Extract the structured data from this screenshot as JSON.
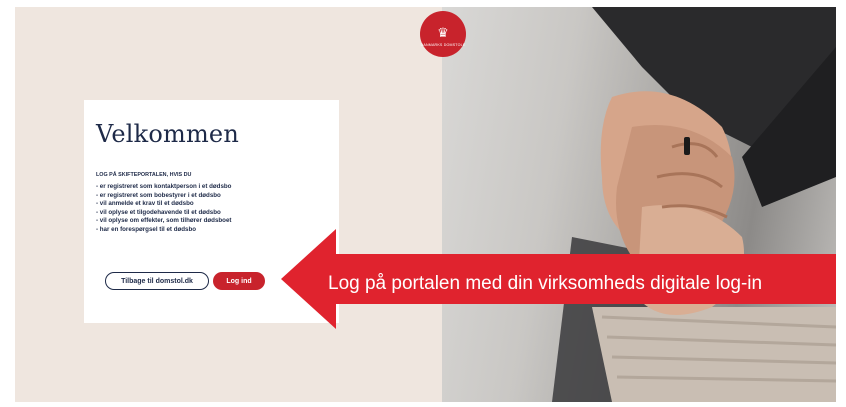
{
  "logo": {
    "symbol": "♛",
    "text": "Danmarks Domstole",
    "color": "#c8232c"
  },
  "card": {
    "title": "Velkommen",
    "subheading": "LOG PÅ SKIFTEPORTALEN, HVIS DU",
    "bullets": [
      "- er registreret som kontaktperson i et dødsbo",
      "- er registreret som bobestyrer i et dødsbo",
      "- vil anmelde et krav til et dødsbo",
      "- vil oplyse et tilgodehavende til et dødsbo",
      "- vil oplyse om effekter, som tilhører dødsboet",
      "- har en forespørgsel til et dødsbo"
    ],
    "back_button_label": "Tilbage til domstol.dk",
    "login_button_label": "Log ind"
  },
  "callout": {
    "text": "Log på portalen med din virksomheds digitale log-in",
    "color": "#e0232e"
  },
  "colors": {
    "left_background": "#efe6df",
    "text_dark": "#1e2a48",
    "accent_red": "#c8232c"
  }
}
